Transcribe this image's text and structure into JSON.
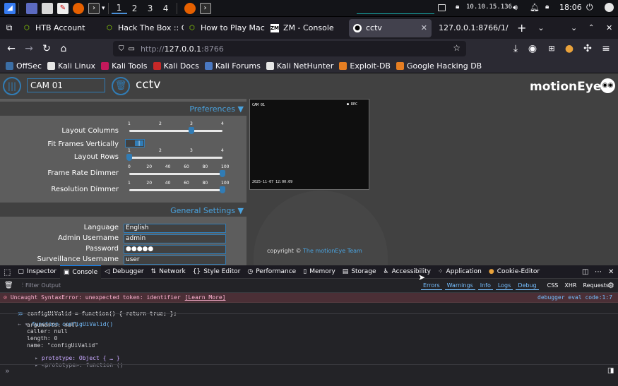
{
  "panel": {
    "workspaces": [
      "1",
      "2",
      "3",
      "4"
    ],
    "ip": "10.10.15.136",
    "clock": "18:06"
  },
  "tabs": [
    {
      "label": "HTB Account",
      "icon": "htb-icon"
    },
    {
      "label": "Hack The Box :: C",
      "icon": "htb-icon"
    },
    {
      "label": "How to Play Mac",
      "icon": "htb-icon"
    },
    {
      "label": "ZM - Console",
      "icon": "zm-icon"
    },
    {
      "label": "cctv",
      "icon": "motioneye-icon"
    },
    {
      "label": "127.0.0.1:8766/1/",
      "icon": "none"
    }
  ],
  "url": {
    "scheme": "http://",
    "host": "127.0.0.1",
    "rest": ":8766"
  },
  "bookmarks": [
    {
      "label": "OffSec",
      "color": "#3b6ea5"
    },
    {
      "label": "Kali Linux",
      "color": "#e6e6e6"
    },
    {
      "label": "Kali Tools",
      "color": "#c2185b"
    },
    {
      "label": "Kali Docs",
      "color": "#c62828"
    },
    {
      "label": "Kali Forums",
      "color": "#4a78c2"
    },
    {
      "label": "Kali NetHunter",
      "color": "#e6e6e6"
    },
    {
      "label": "Exploit-DB",
      "color": "#e67e22"
    },
    {
      "label": "Google Hacking DB",
      "color": "#e67e22"
    }
  ],
  "motioneye": {
    "camera_name_value": "CAM 01",
    "page_title": "cctv",
    "brand": "motionEye",
    "preferences_title": "Preferences",
    "general_title": "General Settings",
    "layout_columns_label": "Layout Columns",
    "layout_columns_ticks": [
      "1",
      "2",
      "3",
      "4"
    ],
    "layout_columns_value": 3,
    "fit_frames_label": "Fit Frames Vertically",
    "layout_rows_label": "Layout Rows",
    "layout_rows_ticks": [
      "1",
      "2",
      "3",
      "4"
    ],
    "layout_rows_value": 1,
    "frame_rate_label": "Frame Rate Dimmer",
    "frame_rate_ticks": [
      "0",
      "20",
      "40",
      "60",
      "80",
      "100"
    ],
    "frame_rate_value": 100,
    "resolution_label": "Resolution Dimmer",
    "resolution_ticks": [
      "1",
      "20",
      "40",
      "60",
      "80",
      "100"
    ],
    "resolution_value": 100,
    "language_label": "Language",
    "language_value": "English",
    "admin_label": "Admin Username",
    "admin_value": "admin",
    "password_label": "Password",
    "password_value": "●●●●●",
    "surveillance_label": "Surveillance Username",
    "surveillance_value": "user",
    "frame_cam_label": "CAM 01",
    "frame_rec": "REC",
    "frame_timestamp": "2025-11-07 12:00:09",
    "copyright_prefix": "copyright © ",
    "copyright_link": "The motionEye Team"
  },
  "devtools": {
    "tabs": [
      {
        "label": "Inspector",
        "icon": "inspector-icon"
      },
      {
        "label": "Console",
        "icon": "console-icon"
      },
      {
        "label": "Debugger",
        "icon": "debugger-icon"
      },
      {
        "label": "Network",
        "icon": "network-icon"
      },
      {
        "label": "Style Editor",
        "icon": "style-editor-icon"
      },
      {
        "label": "Performance",
        "icon": "performance-icon"
      },
      {
        "label": "Memory",
        "icon": "memory-icon"
      },
      {
        "label": "Storage",
        "icon": "storage-icon"
      },
      {
        "label": "Accessibility",
        "icon": "accessibility-icon"
      },
      {
        "label": "Application",
        "icon": "application-icon"
      },
      {
        "label": "Cookie-Editor",
        "icon": "cookie-icon"
      }
    ],
    "filter_placeholder": "Filter Output",
    "filters": [
      "Errors",
      "Warnings",
      "Info",
      "Logs",
      "Debug"
    ],
    "plain_filters": [
      "CSS",
      "XHR",
      "Requests"
    ],
    "error_text": "Uncaught SyntaxError: unexpected token: identifier",
    "error_link": "[Learn More]",
    "error_source": "debugger eval code:1:7",
    "input_line": "configUiValid = function() { return true; };",
    "output_head": "function configUiValid()",
    "props": [
      "arguments: null",
      "caller: null",
      "length: 0",
      "name: \"configUiValid\""
    ],
    "prototype_line": "prototype: Object { … }",
    "proto_line": "<prototype>: function ()",
    "prompt": "»"
  }
}
